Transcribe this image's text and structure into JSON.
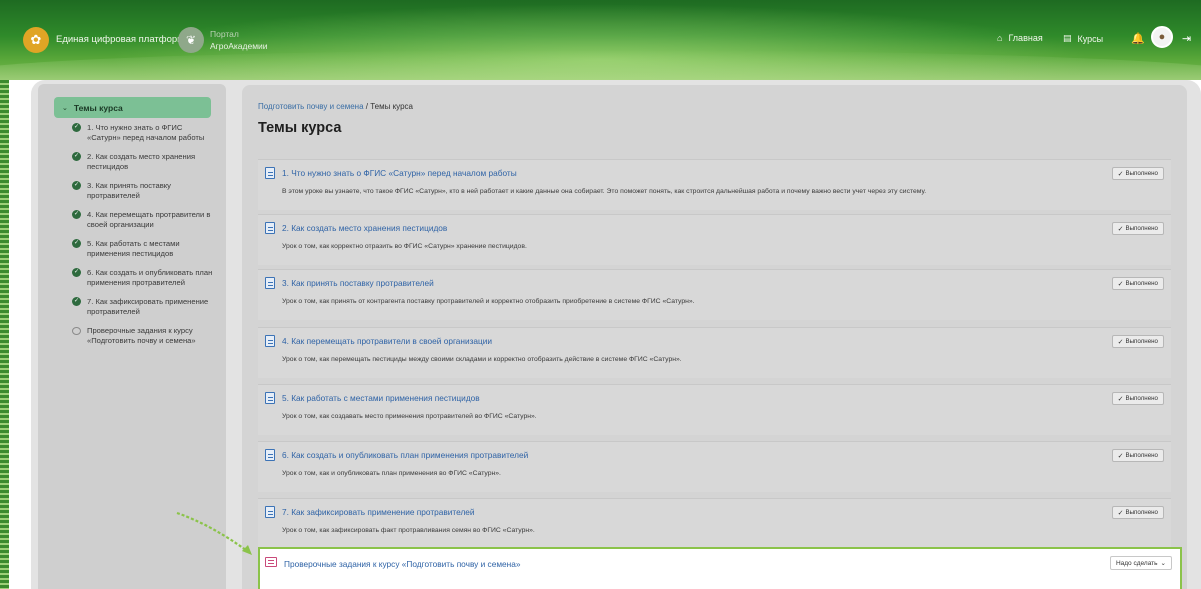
{
  "header": {
    "logo_glyph": "✿",
    "brand": "Единая цифровая платформа",
    "portal_glyph": "❦",
    "portal_line1": "Портал",
    "portal_line2": "АгроАкадемии",
    "nav_home": "Главная",
    "nav_courses": "Курсы",
    "home_icon": "⌂",
    "courses_icon": "▤",
    "bell_icon": "🔔",
    "logout_icon": "⇥"
  },
  "sidebar": {
    "header": "Темы курса",
    "items": [
      {
        "label": "1. Что нужно знать о ФГИС «Сатурн» перед началом работы",
        "done": true
      },
      {
        "label": "2. Как создать место хранения пестицидов",
        "done": true
      },
      {
        "label": "3. Как принять поставку протравителей",
        "done": true
      },
      {
        "label": "4. Как перемещать протравители в своей организации",
        "done": true
      },
      {
        "label": "5. Как работать с местами применения пестицидов",
        "done": true
      },
      {
        "label": "6. Как создать и опубликовать план применения протравителей",
        "done": true
      },
      {
        "label": "7. Как зафиксировать применение протравителей",
        "done": true
      },
      {
        "label": "Проверочные задания к курсу «Подготовить почву и семена»",
        "done": false
      }
    ]
  },
  "breadcrumb": {
    "parent": "Подготовить почву и семена",
    "separator": "/",
    "current": "Темы курса"
  },
  "page_title": "Темы курса",
  "lessons": [
    {
      "title": "1. Что нужно знать о ФГИС «Сатурн» перед началом работы",
      "desc": "В этом уроке вы узнаете, что такое ФГИС «Сатурн», кто в ней работает и какие данные она собирает. Это поможет понять, как строится дальнейшая работа и почему важно вести учет через эту систему.",
      "status": "Выполнено"
    },
    {
      "title": "2. Как создать место хранения пестицидов",
      "desc": "Урок о том, как корректно отразить во ФГИС «Сатурн» хранение пестицидов.",
      "status": "Выполнено"
    },
    {
      "title": "3. Как принять поставку протравителей",
      "desc": "Урок о том, как принять от контрагента поставку протравителей и корректно отобразить приобретение в системе ФГИС «Сатурн».",
      "status": "Выполнено"
    },
    {
      "title": "4. Как перемещать протравители в своей организации",
      "desc": "Урок о том, как перемещать пестициды между своими складами и корректно отобразить действие в системе ФГИС «Сатурн».",
      "status": "Выполнено"
    },
    {
      "title": "5. Как работать с местами применения пестицидов",
      "desc": "Урок о том, как создавать место применения протравителей во ФГИС «Сатурн».",
      "status": "Выполнено"
    },
    {
      "title": "6. Как создать и опубликовать план применения протравителей",
      "desc": "Урок о том, как и опубликовать план применения во ФГИС «Сатурн».",
      "status": "Выполнено"
    },
    {
      "title": "7. Как зафиксировать применение протравителей",
      "desc": "Урок о том, как зафиксировать факт протравливания семян во ФГИС «Сатурн».",
      "status": "Выполнено"
    }
  ],
  "test_item": {
    "title": "Проверочные задания к курсу «Подготовить почву и семена»",
    "status": "Надо сделать"
  },
  "colors": {
    "accent_green": "#8bc34a",
    "link_blue": "#2f63a6",
    "done_icon": "#2e6a3e"
  }
}
